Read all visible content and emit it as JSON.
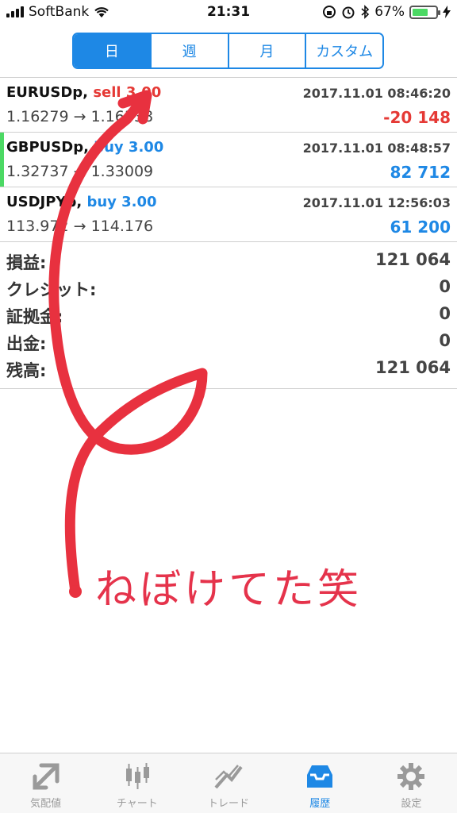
{
  "status": {
    "carrier": "SoftBank",
    "time": "21:31",
    "battery": "67%",
    "battery_level": 0.67
  },
  "period_tabs": [
    {
      "label": "日",
      "active": true
    },
    {
      "label": "週",
      "active": false
    },
    {
      "label": "月",
      "active": false
    },
    {
      "label": "カスタム",
      "active": false
    }
  ],
  "trades": [
    {
      "symbol": "EURUSDp,",
      "side": "sell 3.00",
      "side_type": "sell",
      "time": "2017.11.01 08:46:20",
      "prices": "1.16279 → 1.16338",
      "profit": "-20 148",
      "profit_type": "neg"
    },
    {
      "symbol": "GBPUSDp,",
      "side": "buy 3.00",
      "side_type": "buy",
      "time": "2017.11.01 08:48:57",
      "prices": "1.32737 → 1.33009",
      "profit": "82 712",
      "profit_type": "pos"
    },
    {
      "symbol": "USDJPYp,",
      "side": "buy 3.00",
      "side_type": "buy",
      "time": "2017.11.01 12:56:03",
      "prices": "113.972 → 114.176",
      "profit": "61 200",
      "profit_type": "pos"
    }
  ],
  "summary": [
    {
      "label": "損益:",
      "value": "121 064"
    },
    {
      "label": "クレジット:",
      "value": "0"
    },
    {
      "label": "証拠金:",
      "value": "0"
    },
    {
      "label": "出金:",
      "value": "0"
    },
    {
      "label": "残高:",
      "value": "121 064"
    }
  ],
  "annotation_text": "ねぼけてた笑",
  "tabbar": [
    {
      "label": "気配値",
      "icon": "quotes-icon",
      "active": false
    },
    {
      "label": "チャート",
      "icon": "chart-icon",
      "active": false
    },
    {
      "label": "トレード",
      "icon": "trade-icon",
      "active": false
    },
    {
      "label": "履歴",
      "icon": "history-icon",
      "active": true
    },
    {
      "label": "設定",
      "icon": "settings-icon",
      "active": false
    }
  ],
  "colors": {
    "accent": "#1e88e5",
    "sell": "#e53935",
    "annotation": "#e5334b"
  }
}
